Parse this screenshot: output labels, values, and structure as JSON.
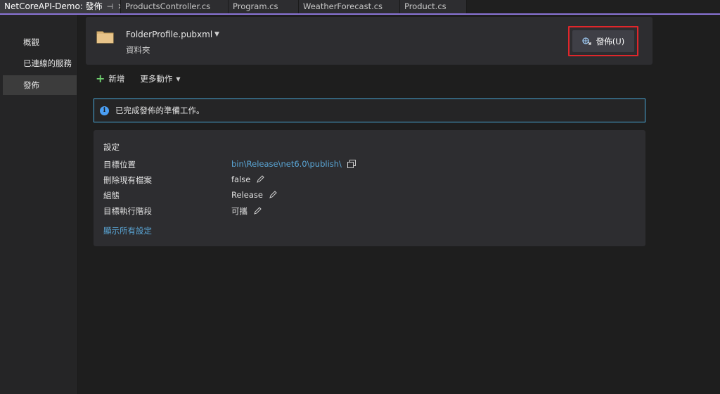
{
  "tabs": [
    {
      "label": "NetCoreAPI-Demo: 發佈",
      "active": true
    },
    {
      "label": "ProductsController.cs",
      "active": false
    },
    {
      "label": "Program.cs",
      "active": false
    },
    {
      "label": "WeatherForecast.cs",
      "active": false
    },
    {
      "label": "Product.cs",
      "active": false
    }
  ],
  "tab_icons": {
    "pin": "pin-icon",
    "close": "close-icon"
  },
  "nav": {
    "items": [
      {
        "label": "概觀",
        "selected": false
      },
      {
        "label": "已連線的服務",
        "selected": false
      },
      {
        "label": "發佈",
        "selected": true
      }
    ]
  },
  "profile": {
    "name": "FolderProfile.pubxml",
    "type": "資料夾",
    "icon": "folder-icon"
  },
  "publish_button": {
    "label": "發佈(U)",
    "icon": "publish-globe-icon"
  },
  "actions": {
    "new_label": "新增",
    "more_label": "更多動作"
  },
  "info": {
    "text": "已完成發佈的準備工作。",
    "icon": "info-icon"
  },
  "settings": {
    "title": "設定",
    "rows": [
      {
        "key": "目標位置",
        "value": "bin\\Release\\net6.0\\publish\\",
        "action_icon": "copy-icon"
      },
      {
        "key": "刪除現有檔案",
        "value": "false",
        "action_icon": "edit-icon"
      },
      {
        "key": "組態",
        "value": "Release",
        "action_icon": "edit-icon"
      },
      {
        "key": "目標執行階段",
        "value": "可攜",
        "action_icon": "edit-icon"
      }
    ],
    "show_all_label": "顯示所有設定"
  },
  "colors": {
    "accent_tab_border": "#8a74d6",
    "highlight_outline": "#e0262b",
    "link": "#5aa6d6",
    "info_border": "#4aa8d8"
  }
}
